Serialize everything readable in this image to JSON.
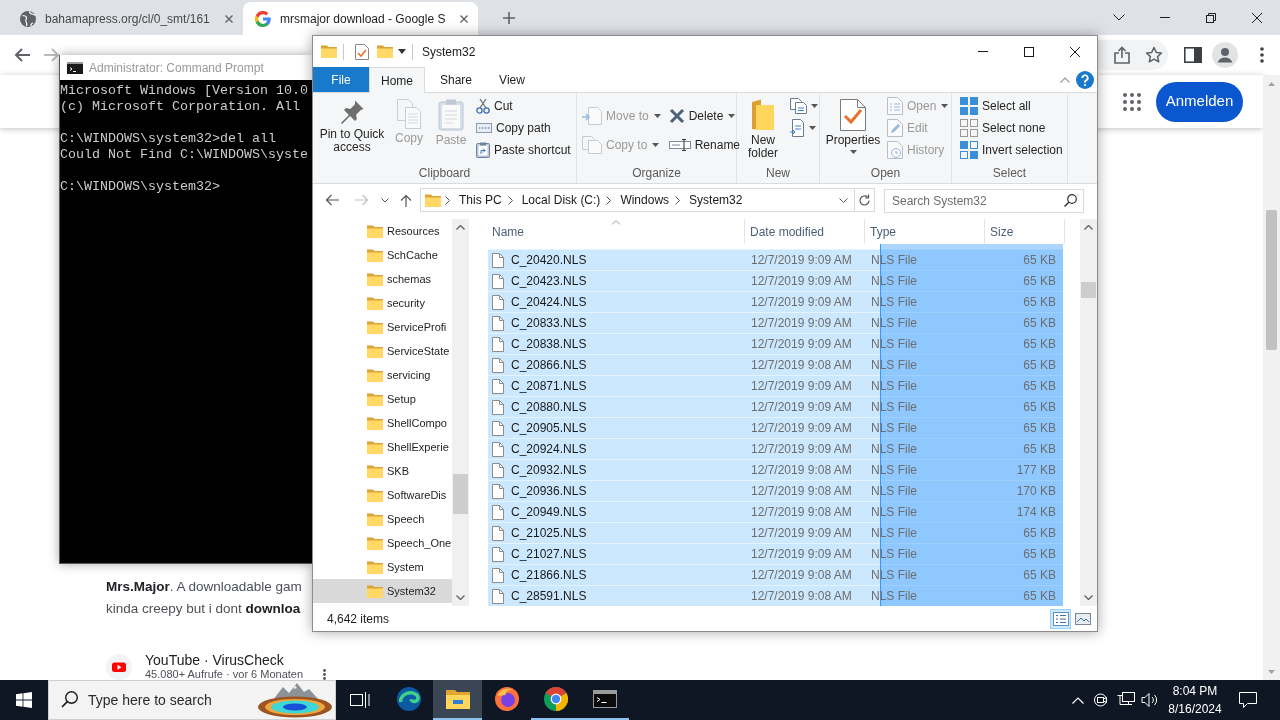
{
  "browser": {
    "tabs": [
      {
        "title": "bahamapress.org/cl/0_smt/161",
        "selected": false
      },
      {
        "title": "mrsmajor download - Google S",
        "selected": true
      }
    ],
    "sign_in_button": "Anmelden",
    "results": [
      {
        "kind": "snippet",
        "lines": [
          "**Mrs.Major**. A downloadable gam",
          "kinda creepy but i dont **downloa**"
        ]
      },
      {
        "kind": "source",
        "site": "YouTube · VirusCheck",
        "meta": "45.080+ Aufrufe · vor 6 Monaten"
      }
    ]
  },
  "command_prompt": {
    "title": "Administrator: Command Prompt",
    "blocks": [
      [
        "Microsoft Windows [Version 10.0",
        "(c) Microsoft Corporation. All"
      ],
      [
        "C:\\WINDOWS\\system32>del all",
        "Could Not Find C:\\WINDOWS\\syste"
      ],
      [
        "C:\\WINDOWS\\system32>"
      ]
    ]
  },
  "explorer": {
    "title": "System32",
    "ribbon_tabs": [
      {
        "label": "File",
        "kind": "backstage",
        "selected": false
      },
      {
        "label": "Home",
        "kind": "tab",
        "selected": true
      },
      {
        "label": "Share",
        "kind": "tab",
        "selected": false
      },
      {
        "label": "View",
        "kind": "tab",
        "selected": false
      }
    ],
    "ribbon_groups": [
      {
        "label": "Clipboard",
        "columns": [
          [
            {
              "label": "Pin to Quick access",
              "kind": "large",
              "dropdown": false,
              "disabled": false
            }
          ],
          [
            {
              "label": "Copy",
              "kind": "large",
              "dropdown": false,
              "disabled": true
            }
          ],
          [
            {
              "label": "Paste",
              "kind": "large",
              "dropdown": false,
              "disabled": true
            }
          ],
          [
            {
              "label": "Cut",
              "kind": "small",
              "dropdown": false,
              "disabled": false
            },
            {
              "label": "Copy path",
              "kind": "small",
              "dropdown": false,
              "disabled": false
            },
            {
              "label": "Paste shortcut",
              "kind": "small",
              "dropdown": false,
              "disabled": false
            }
          ]
        ]
      },
      {
        "label": "Organize",
        "columns": [
          [
            {
              "label": "Move to",
              "kind": "small",
              "dropdown": true,
              "disabled": true
            },
            {
              "label": "Copy to",
              "kind": "small",
              "dropdown": true,
              "disabled": true
            }
          ],
          [
            {
              "label": "Delete",
              "kind": "small",
              "dropdown": true,
              "disabled": false
            },
            {
              "label": "Rename",
              "kind": "small",
              "dropdown": false,
              "disabled": false
            }
          ]
        ]
      },
      {
        "label": "New",
        "columns": [
          [
            {
              "label": "New folder",
              "kind": "large",
              "dropdown": false,
              "disabled": false
            }
          ],
          [
            {
              "kind": "icon",
              "dropdown": true,
              "disabled": false
            },
            {
              "kind": "icon",
              "dropdown": true,
              "disabled": false
            }
          ]
        ]
      },
      {
        "label": "Open",
        "columns": [
          [
            {
              "label": "Properties",
              "kind": "large",
              "dropdown": true,
              "disabled": false
            }
          ],
          [
            {
              "label": "Open",
              "kind": "small",
              "dropdown": true,
              "disabled": true
            },
            {
              "label": "Edit",
              "kind": "small",
              "dropdown": false,
              "disabled": true
            },
            {
              "label": "History",
              "kind": "small",
              "dropdown": false,
              "disabled": true
            }
          ]
        ]
      },
      {
        "label": "Select",
        "columns": [
          [
            {
              "label": "Select all",
              "kind": "small",
              "dropdown": false,
              "disabled": false
            },
            {
              "label": "Select none",
              "kind": "small",
              "dropdown": false,
              "disabled": false
            },
            {
              "label": "Invert selection",
              "kind": "small",
              "dropdown": false,
              "disabled": false
            }
          ]
        ]
      }
    ],
    "address": {
      "path": [
        "This PC",
        "Local Disk (C:)",
        "Windows",
        "System32"
      ]
    },
    "search": {
      "placeholder": "Search System32"
    },
    "navigation": [
      {
        "label": "Resources",
        "selected": false
      },
      {
        "label": "SchCache",
        "selected": false
      },
      {
        "label": "schemas",
        "selected": false
      },
      {
        "label": "security",
        "selected": false
      },
      {
        "label": "ServiceProfi",
        "selected": false
      },
      {
        "label": "ServiceState",
        "selected": false
      },
      {
        "label": "servicing",
        "selected": false
      },
      {
        "label": "Setup",
        "selected": false
      },
      {
        "label": "ShellCompo",
        "selected": false
      },
      {
        "label": "ShellExperie",
        "selected": false
      },
      {
        "label": "SKB",
        "selected": false
      },
      {
        "label": "SoftwareDis",
        "selected": false
      },
      {
        "label": "Speech",
        "selected": false
      },
      {
        "label": "Speech_One",
        "selected": false
      },
      {
        "label": "System",
        "selected": false
      },
      {
        "label": "System32",
        "selected": true
      }
    ],
    "columns": [
      {
        "label": "Name",
        "sorted": true
      },
      {
        "label": "Date modified",
        "sorted": false
      },
      {
        "label": "Type",
        "sorted": false
      },
      {
        "label": "Size",
        "sorted": false
      }
    ],
    "files": [
      {
        "name": "C_20420.NLS",
        "date_modified": "12/7/2019 9:09 AM",
        "type": "NLS File",
        "size": "65 KB",
        "selected": true
      },
      {
        "name": "C_20423.NLS",
        "date_modified": "12/7/2019 9:09 AM",
        "type": "NLS File",
        "size": "65 KB",
        "selected": true
      },
      {
        "name": "C_20424.NLS",
        "date_modified": "12/7/2019 9:09 AM",
        "type": "NLS File",
        "size": "65 KB",
        "selected": true
      },
      {
        "name": "C_20833.NLS",
        "date_modified": "12/7/2019 9:09 AM",
        "type": "NLS File",
        "size": "65 KB",
        "selected": true
      },
      {
        "name": "C_20838.NLS",
        "date_modified": "12/7/2019 9:09 AM",
        "type": "NLS File",
        "size": "65 KB",
        "selected": true
      },
      {
        "name": "C_20866.NLS",
        "date_modified": "12/7/2019 9:08 AM",
        "type": "NLS File",
        "size": "65 KB",
        "selected": true
      },
      {
        "name": "C_20871.NLS",
        "date_modified": "12/7/2019 9:09 AM",
        "type": "NLS File",
        "size": "65 KB",
        "selected": true
      },
      {
        "name": "C_20880.NLS",
        "date_modified": "12/7/2019 9:09 AM",
        "type": "NLS File",
        "size": "65 KB",
        "selected": true
      },
      {
        "name": "C_20905.NLS",
        "date_modified": "12/7/2019 9:09 AM",
        "type": "NLS File",
        "size": "65 KB",
        "selected": true
      },
      {
        "name": "C_20924.NLS",
        "date_modified": "12/7/2019 9:09 AM",
        "type": "NLS File",
        "size": "65 KB",
        "selected": true
      },
      {
        "name": "C_20932.NLS",
        "date_modified": "12/7/2019 9:08 AM",
        "type": "NLS File",
        "size": "177 KB",
        "selected": true
      },
      {
        "name": "C_20936.NLS",
        "date_modified": "12/7/2019 9:08 AM",
        "type": "NLS File",
        "size": "170 KB",
        "selected": true
      },
      {
        "name": "C_20949.NLS",
        "date_modified": "12/7/2019 9:08 AM",
        "type": "NLS File",
        "size": "174 KB",
        "selected": true
      },
      {
        "name": "C_21025.NLS",
        "date_modified": "12/7/2019 9:09 AM",
        "type": "NLS File",
        "size": "65 KB",
        "selected": true
      },
      {
        "name": "C_21027.NLS",
        "date_modified": "12/7/2019 9:09 AM",
        "type": "NLS File",
        "size": "65 KB",
        "selected": true
      },
      {
        "name": "C_21866.NLS",
        "date_modified": "12/7/2019 9:08 AM",
        "type": "NLS File",
        "size": "65 KB",
        "selected": true
      },
      {
        "name": "C_28591.NLS",
        "date_modified": "12/7/2019 9:08 AM",
        "type": "NLS File",
        "size": "65 KB",
        "selected": true
      }
    ],
    "status": "4,642 items",
    "views": [
      {
        "selected": true
      },
      {
        "selected": false
      }
    ]
  },
  "taskbar": {
    "search": {
      "placeholder": "Type here to search"
    },
    "apps": [
      {
        "running": false,
        "focused": false
      },
      {
        "running": true,
        "focused": true
      },
      {
        "running": false,
        "focused": false
      },
      {
        "running": true,
        "focused": false
      },
      {
        "running": true,
        "focused": false
      }
    ],
    "clock": {
      "time": "8:04 PM",
      "date": "8/16/2024"
    }
  }
}
